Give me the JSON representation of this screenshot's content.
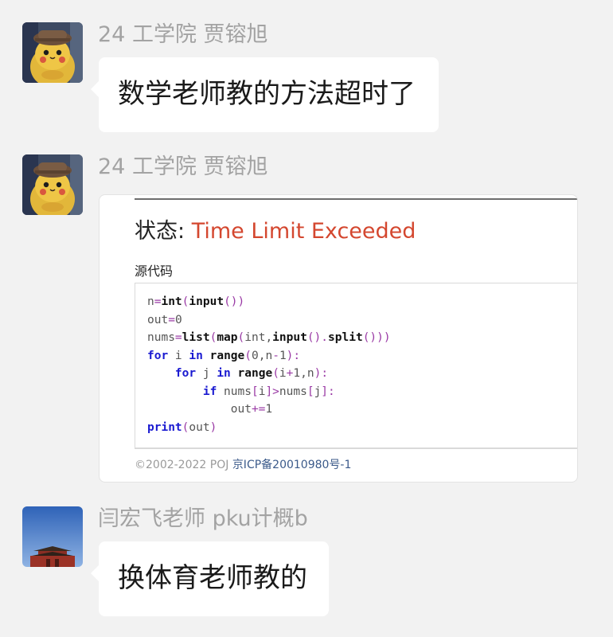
{
  "messages": [
    {
      "sender": "24 工学院 贾镕旭",
      "avatar": "pikachu-detective-avatar",
      "text": "数学老师教的方法超时了"
    },
    {
      "sender": "24 工学院 贾镕旭",
      "avatar": "pikachu-detective-avatar",
      "image": {
        "status_label": "状态:",
        "status_value": "Time Limit Exceeded",
        "source_title": "源代码",
        "code_lines": [
          "n=int(input())",
          "out=0",
          "nums=list(map(int,input().split()))",
          "for i in range(0,n-1):",
          "    for j in range(i+1,n):",
          "        if nums[i]>nums[j]:",
          "            out+=1",
          "print(out)"
        ],
        "footer_copyright": "©2002-2022 POJ",
        "footer_icp": "京ICP备20010980号-1"
      }
    },
    {
      "sender": "闫宏飞老师 pku计概b",
      "avatar": "forbidden-city-avatar",
      "text": "换体育老师教的"
    }
  ],
  "colors": {
    "background": "#f2f2f2",
    "bubble": "#ffffff",
    "sender_name": "#a3a3a3",
    "status_tle": "#d4472f",
    "keyword": "#1a1ad1",
    "operator": "#9a3aa5",
    "icp_link": "#3b5a8a"
  }
}
